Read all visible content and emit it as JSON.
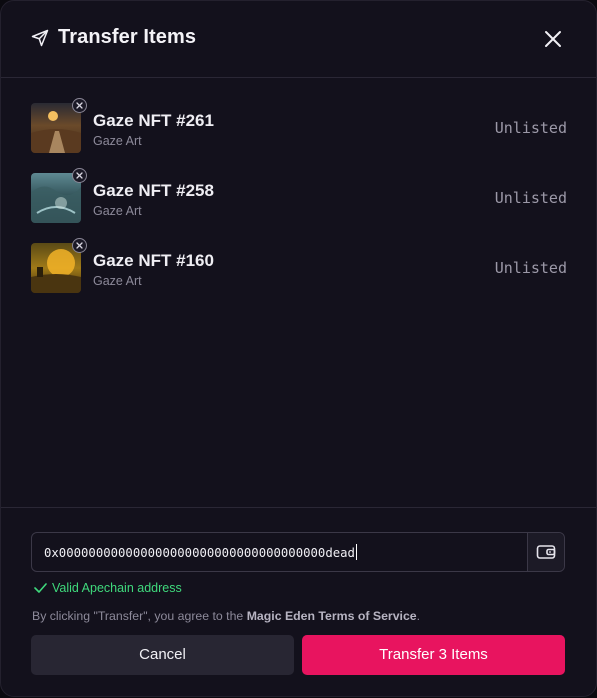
{
  "header": {
    "title": "Transfer Items",
    "send_icon": "send-icon",
    "close_icon": "close-icon"
  },
  "items": [
    {
      "name": "Gaze NFT #261",
      "collection": "Gaze Art",
      "status": "Unlisted"
    },
    {
      "name": "Gaze NFT #258",
      "collection": "Gaze Art",
      "status": "Unlisted"
    },
    {
      "name": "Gaze NFT #160",
      "collection": "Gaze Art",
      "status": "Unlisted"
    }
  ],
  "footer": {
    "address_value": "0x000000000000000000000000000000000000dead",
    "wallet_icon": "wallet-icon",
    "validation_text": "Valid Apechain address",
    "terms_prefix": "By clicking \"Transfer\", you agree to the ",
    "terms_link": "Magic Eden Terms of Service",
    "terms_suffix": ".",
    "cancel_label": "Cancel",
    "transfer_label": "Transfer 3 Items"
  },
  "colors": {
    "accent": "#e8145f",
    "valid": "#3fd97c",
    "background": "#13111c"
  }
}
